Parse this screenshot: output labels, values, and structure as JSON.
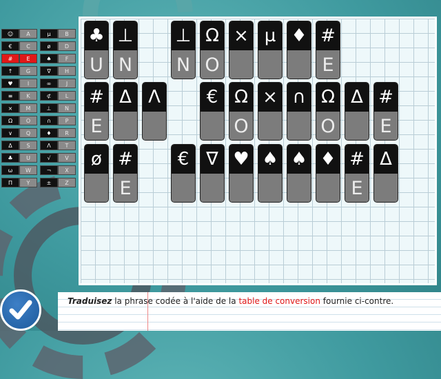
{
  "conversion_table": [
    {
      "left": {
        "symbol": "☺",
        "letter": "A"
      },
      "right": {
        "symbol": "µ",
        "letter": "B"
      }
    },
    {
      "left": {
        "symbol": "€",
        "letter": "C"
      },
      "right": {
        "symbol": "ø",
        "letter": "D"
      }
    },
    {
      "left": {
        "symbol": "#",
        "letter": "E",
        "highlight": true
      },
      "right": {
        "symbol": "♠",
        "letter": "F"
      }
    },
    {
      "left": {
        "symbol": "↑",
        "letter": "G"
      },
      "right": {
        "symbol": "∇",
        "letter": "H"
      }
    },
    {
      "left": {
        "symbol": "♥",
        "letter": "I"
      },
      "right": {
        "symbol": "∞",
        "letter": "J"
      }
    },
    {
      "left": {
        "symbol": "≡",
        "letter": "K"
      },
      "right": {
        "symbol": "⊄",
        "letter": "L"
      }
    },
    {
      "left": {
        "symbol": "×",
        "letter": "M"
      },
      "right": {
        "symbol": "⊥",
        "letter": "N"
      }
    },
    {
      "left": {
        "symbol": "Ω",
        "letter": "O"
      },
      "right": {
        "symbol": "∩",
        "letter": "P"
      }
    },
    {
      "left": {
        "symbol": "∨",
        "letter": "Q"
      },
      "right": {
        "symbol": "♦",
        "letter": "R"
      }
    },
    {
      "left": {
        "symbol": "Δ",
        "letter": "S"
      },
      "right": {
        "symbol": "Λ",
        "letter": "T"
      }
    },
    {
      "left": {
        "symbol": "♣",
        "letter": "U"
      },
      "right": {
        "symbol": "√",
        "letter": "V"
      }
    },
    {
      "left": {
        "symbol": "ω",
        "letter": "W"
      },
      "right": {
        "symbol": "¬",
        "letter": "X"
      }
    },
    {
      "left": {
        "symbol": "Π",
        "letter": "Y"
      },
      "right": {
        "symbol": "±",
        "letter": "Z"
      }
    }
  ],
  "puzzle_rows": [
    [
      {
        "symbol": "♣",
        "letter": "U"
      },
      {
        "symbol": "⊥",
        "letter": "N"
      },
      null,
      {
        "symbol": "⊥",
        "letter": "N"
      },
      {
        "symbol": "Ω",
        "letter": "O"
      },
      {
        "symbol": "×",
        "letter": ""
      },
      {
        "symbol": "µ",
        "letter": ""
      },
      {
        "symbol": "♦",
        "letter": ""
      },
      {
        "symbol": "#",
        "letter": "E"
      }
    ],
    [
      {
        "symbol": "#",
        "letter": "E"
      },
      {
        "symbol": "Δ",
        "letter": ""
      },
      {
        "symbol": "Λ",
        "letter": ""
      },
      null,
      {
        "symbol": "€",
        "letter": ""
      },
      {
        "symbol": "Ω",
        "letter": "O"
      },
      {
        "symbol": "×",
        "letter": ""
      },
      {
        "symbol": "∩",
        "letter": ""
      },
      {
        "symbol": "Ω",
        "letter": "O"
      },
      {
        "symbol": "Δ",
        "letter": ""
      },
      {
        "symbol": "#",
        "letter": "E"
      }
    ],
    [
      {
        "symbol": "ø",
        "letter": ""
      },
      {
        "symbol": "#",
        "letter": "E"
      },
      null,
      {
        "symbol": "€",
        "letter": ""
      },
      {
        "symbol": "∇",
        "letter": ""
      },
      {
        "symbol": "♥",
        "letter": ""
      },
      {
        "symbol": "♠",
        "letter": ""
      },
      {
        "symbol": "♠",
        "letter": ""
      },
      {
        "symbol": "♦",
        "letter": ""
      },
      {
        "symbol": "#",
        "letter": "E"
      },
      {
        "symbol": "Δ",
        "letter": ""
      }
    ]
  ],
  "instruction": {
    "part1": "Traduisez",
    "part2": " la phrase codée à l'aide de la ",
    "part3": "table de conversion",
    "part4": " fournie ci-contre."
  },
  "validate_icon": "checkmark-icon",
  "colors": {
    "highlight": "#e01818",
    "tile_top": "#111111",
    "tile_bottom": "#7c7c7c",
    "validate": "#1d5a9c"
  }
}
